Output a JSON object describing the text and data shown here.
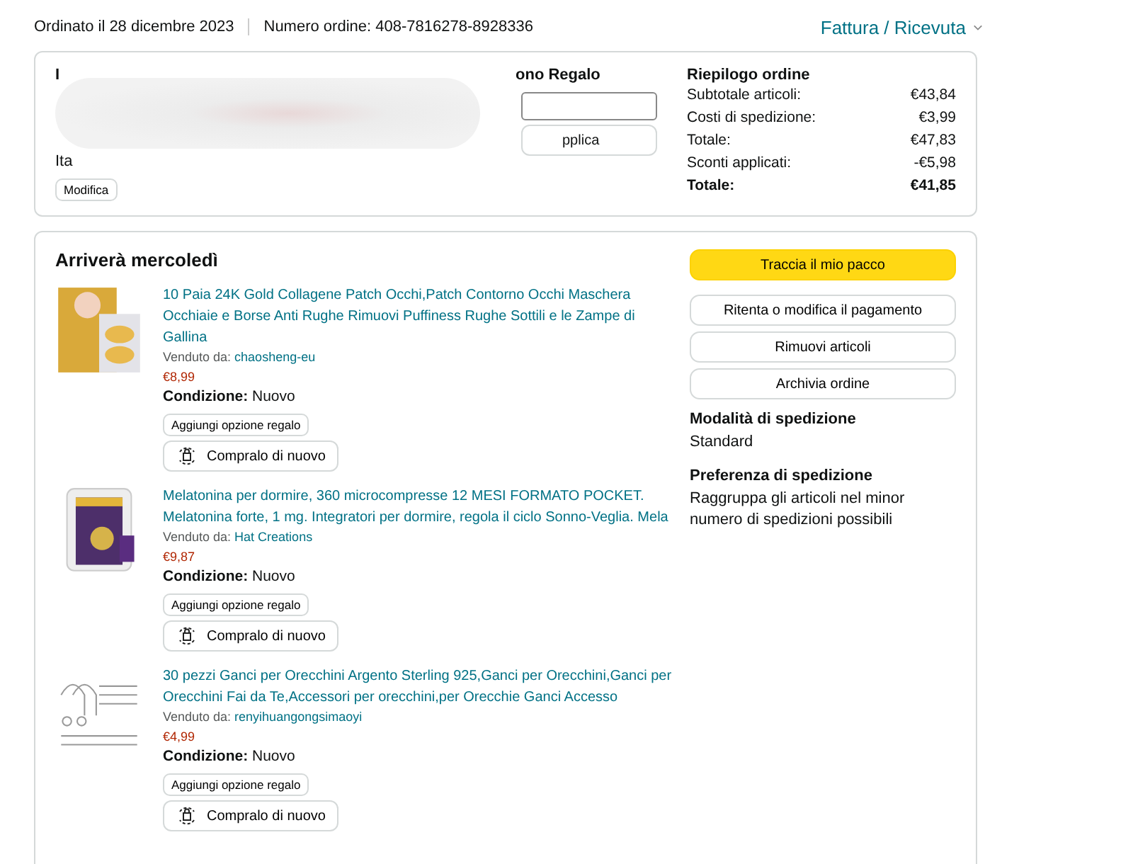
{
  "header": {
    "order_date": "Ordinato il 28 dicembre 2023",
    "order_number": "Numero ordine: 408-7816278-8928336",
    "invoice_link": "Fattura / Ricevuta"
  },
  "info_card": {
    "address_heading": "I",
    "address_line": "Ita",
    "edit_button": "Modifica",
    "gift_heading": "ono Regalo",
    "apply_button": "pplica",
    "summary": {
      "title": "Riepilogo ordine",
      "rows": [
        {
          "label": "Subtotale articoli:",
          "value": "€43,84",
          "kind": "normal"
        },
        {
          "label": "Costi di spedizione:",
          "value": "€3,99",
          "kind": "normal"
        },
        {
          "label": "Totale:",
          "value": "€47,83",
          "kind": "normal"
        },
        {
          "label": "Sconti applicati:",
          "value": "-€5,98",
          "kind": "normal"
        },
        {
          "label": "Totale:",
          "value": "€41,85",
          "kind": "grand"
        }
      ]
    }
  },
  "shipment": {
    "heading": "Arriverà mercoledì",
    "items": [
      {
        "title": "10 Paia 24K Gold Collagene Patch Occhi,Patch Contorno Occhi Maschera Occhiaie e Borse Anti Rughe Rimuovi Puffiness Rughe Sottili e le Zampe di Gallina",
        "seller_label": "Venduto da:",
        "seller": "chaosheng-eu",
        "price": "€8,99",
        "condition_label": "Condizione:",
        "condition": "Nuovo",
        "gift_button": "Aggiungi opzione regalo",
        "buy_again_button": "Compralo di nuovo"
      },
      {
        "title": "Melatonina per dormire, 360 microcompresse 12 MESI FORMATO POCKET. Melatonina forte, 1 mg. Integratori per dormire, regola il ciclo Sonno-Veglia. Mela",
        "seller_label": "Venduto da:",
        "seller": "Hat Creations",
        "price": "€9,87",
        "condition_label": "Condizione:",
        "condition": "Nuovo",
        "gift_button": "Aggiungi opzione regalo",
        "buy_again_button": "Compralo di nuovo"
      },
      {
        "title": "30 pezzi Ganci per Orecchini Argento Sterling 925,Ganci per Orecchini,Ganci per Orecchini Fai da Te,Accessori per orecchini,per Orecchie Ganci Accesso",
        "seller_label": "Venduto da:",
        "seller": "renyihuangongsimaoyi",
        "price": "€4,99",
        "condition_label": "Condizione:",
        "condition": "Nuovo",
        "gift_button": "Aggiungi opzione regalo",
        "buy_again_button": "Compralo di nuovo"
      }
    ],
    "actions": [
      {
        "label": "Traccia il mio pacco",
        "kind": "primary"
      },
      {
        "label": "Ritenta o modifica il pagamento",
        "kind": "secondary"
      },
      {
        "label": "Rimuovi articoli",
        "kind": "secondary"
      },
      {
        "label": "Archivia ordine",
        "kind": "secondary"
      }
    ],
    "shipping_method_heading": "Modalità di spedizione",
    "shipping_method": "Standard",
    "preference_heading": "Preferenza di spedizione",
    "preference": "Raggruppa gli articoli nel minor numero di spedizioni possibili"
  }
}
